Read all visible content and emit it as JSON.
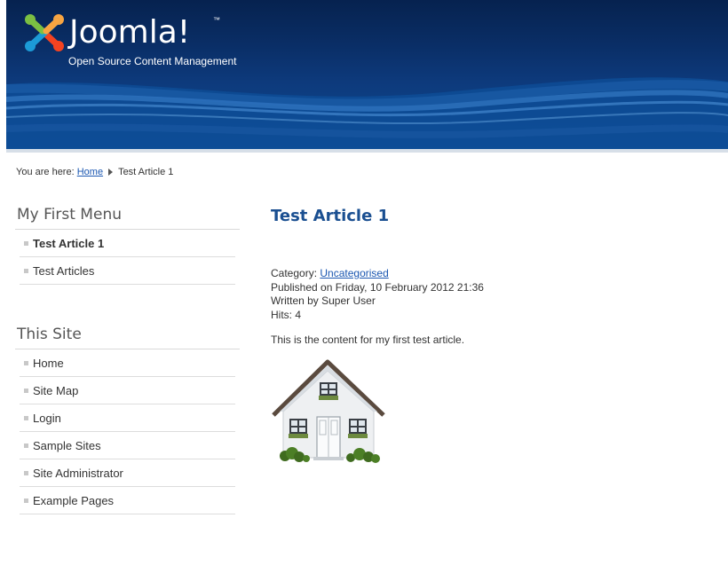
{
  "header": {
    "logo_text": "Joomla!",
    "logo_tm": "™",
    "tagline": "Open Source Content Management"
  },
  "breadcrumb": {
    "prefix": "You are here:",
    "home": "Home",
    "current": "Test Article 1"
  },
  "menus": [
    {
      "title": "My First Menu",
      "items": [
        {
          "label": "Test Article 1",
          "active": true
        },
        {
          "label": "Test Articles",
          "active": false
        }
      ]
    },
    {
      "title": "This Site",
      "items": [
        {
          "label": "Home"
        },
        {
          "label": "Site Map"
        },
        {
          "label": "Login"
        },
        {
          "label": "Sample Sites"
        },
        {
          "label": "Site Administrator"
        },
        {
          "label": "Example Pages"
        }
      ]
    }
  ],
  "article": {
    "title": "Test Article 1",
    "category_label": "Category:",
    "category": "Uncategorised",
    "published": "Published on Friday, 10 February 2012 21:36",
    "author": "Written by Super User",
    "hits": "Hits: 4",
    "body": "This is the content for my first test article."
  },
  "colors": {
    "header_bg": "#0d3a7c",
    "title_blue": "#1a4f91",
    "link": "#1b57b1"
  }
}
